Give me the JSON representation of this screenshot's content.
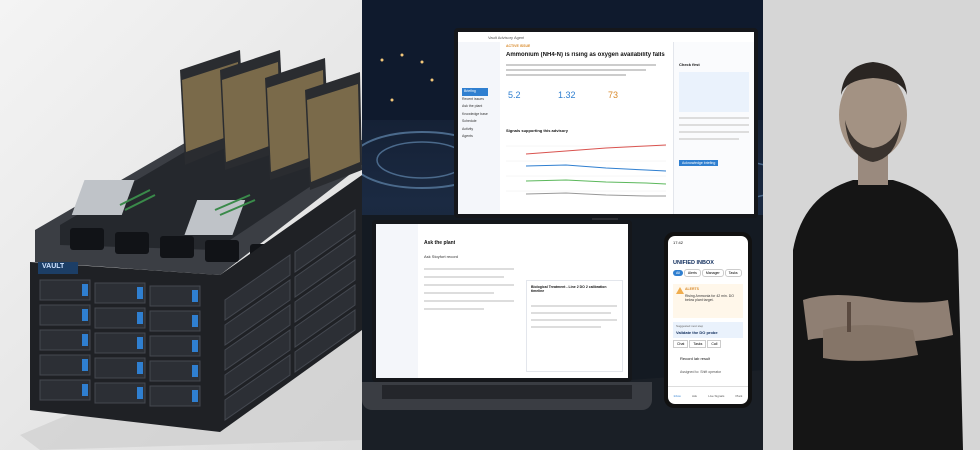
{
  "server": {
    "brand": "VAULT",
    "colors": {
      "chassis": "#2b2d31",
      "face": "#1f2125",
      "gpu": "#7a6a4a",
      "accent": "#2f7fd0"
    }
  },
  "monitor": {
    "app_name": "Vault Advisory Agent",
    "sidebar_items": [
      "Briefing",
      "Recent issues",
      "Ask the plant",
      "Knowledge base",
      "Schedule",
      "Activity",
      "Agents"
    ],
    "banner": "ACTIVE ISSUE",
    "headline": "Ammonium (NH4-N) is rising as oxygen availability falls",
    "stat_values": [
      "5.2",
      "1.32",
      "73"
    ],
    "chart_title": "Signals supporting this advisory",
    "right_title": "Check first",
    "button_label": "Acknowledge briefing"
  },
  "laptop": {
    "window_title": "Ask the plant",
    "question_title": "Ask Stoyfort record",
    "card_title": "Biological Treatment - Line 2 DO 2 calibration timeline"
  },
  "phone": {
    "time": "17:42",
    "title": "UNIFIED INBOX",
    "filters": [
      "All",
      "Alerts",
      "Manager",
      "Tasks"
    ],
    "alert_tag": "ALERTS",
    "alert_text": "Rising Ammonia for 42 min. DO below plant target.",
    "suggested_label": "Suggested next step",
    "suggested_text": "Validate the DO probe",
    "actions": [
      "Chat",
      "Tasks",
      "Call"
    ],
    "list": [
      "Record lab result",
      "Assigned to: Shift operator"
    ],
    "nav": [
      "Inbox",
      "Ask",
      "Live Signals",
      "Plant"
    ]
  },
  "person": {
    "shirt_color": "#151515"
  }
}
